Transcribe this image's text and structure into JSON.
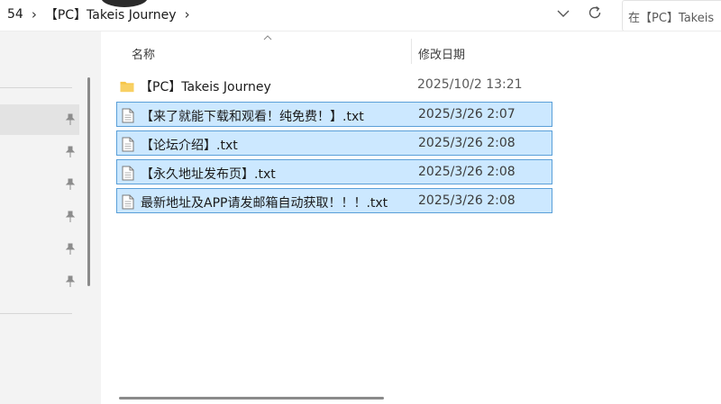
{
  "address_bar": {
    "breadcrumb": [
      "54",
      "【PC】Takeis Journey"
    ],
    "separator": "›",
    "search_placeholder": "在【PC】Takeis"
  },
  "columns": {
    "name": "名称",
    "date_modified": "修改日期"
  },
  "files": [
    {
      "icon": "folder-icon",
      "name": "【PC】Takeis Journey",
      "date": "2025/10/2 13:21",
      "selected": false
    },
    {
      "icon": "text-file-icon",
      "name": "【来了就能下载和观看！纯免费！】.txt",
      "date": "2025/3/26 2:07",
      "selected": true
    },
    {
      "icon": "text-file-icon",
      "name": "【论坛介绍】.txt",
      "date": "2025/3/26 2:08",
      "selected": true
    },
    {
      "icon": "text-file-icon",
      "name": "【永久地址发布页】.txt",
      "date": "2025/3/26 2:08",
      "selected": true
    },
    {
      "icon": "text-file-icon",
      "name": "最新地址及APP请发邮箱自动获取！！！.txt",
      "date": "2025/3/26 2:08",
      "selected": true
    }
  ],
  "colors": {
    "selection_fill": "#cce8ff",
    "selection_border": "#5a9fd8",
    "folder": "#f6c548",
    "nav_background": "#f3f3f3"
  }
}
